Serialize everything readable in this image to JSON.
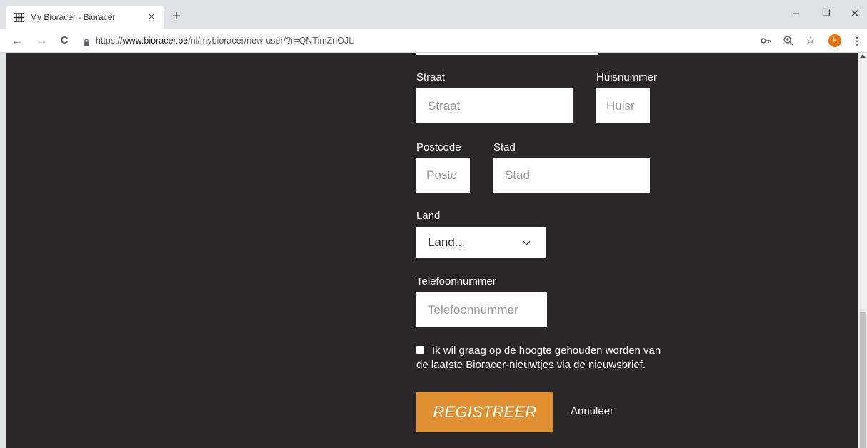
{
  "browser": {
    "tab_title": "My Bioracer - Bioracer",
    "tab_close": "×",
    "new_tab": "+",
    "url_scheme": "https://",
    "url_host": "www.bioracer.be",
    "url_path": "/nl/mybioracer/new-user/?r=QNTimZnOJL",
    "profile_initial": "k",
    "window_controls": {
      "minimize": "–",
      "restore": "❐",
      "close": "✕"
    },
    "nav": {
      "back": "←",
      "forward": "→",
      "reload": "C"
    },
    "icons": {
      "key": "key-icon",
      "zoom": "zoom-icon",
      "bookmark": "star-icon",
      "menu": "kebab-menu-icon"
    },
    "accent_color": "#e8710a"
  },
  "form": {
    "street": {
      "label": "Straat",
      "placeholder": "Straat"
    },
    "house_number": {
      "label": "Huisnummer",
      "placeholder": "Huisr"
    },
    "postcode": {
      "label": "Postcode",
      "placeholder": "Postc"
    },
    "city": {
      "label": "Stad",
      "placeholder": "Stad"
    },
    "country": {
      "label": "Land",
      "selected": "Land..."
    },
    "phone": {
      "label": "Telefoonnummer",
      "placeholder": "Telefoonnummer"
    },
    "newsletter": {
      "line1": "Ik wil graag op de hoogte gehouden worden van",
      "line2": "de laatste Bioracer-nieuwtjes via de nieuwsbrief.",
      "checked": false
    },
    "register_label": "REGISTREER",
    "cancel_label": "Annuleer",
    "register_color": "#e09031",
    "page_background": "#292727"
  }
}
